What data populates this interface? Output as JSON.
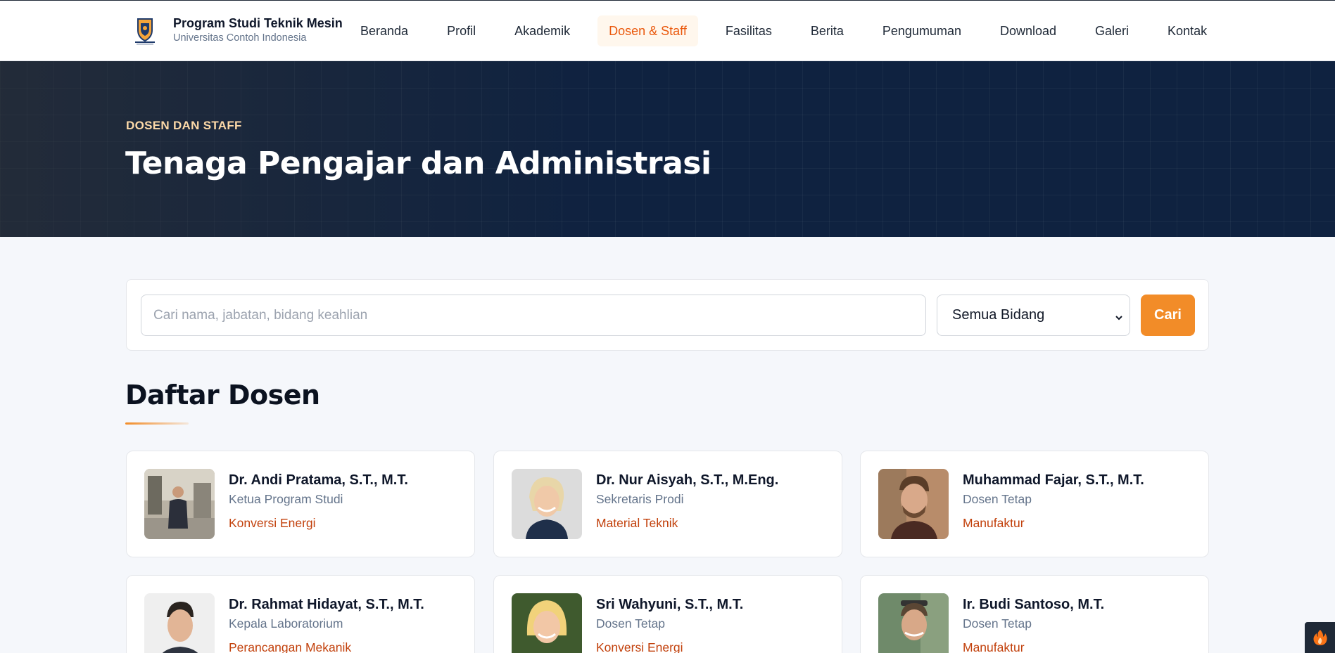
{
  "brand": {
    "title": "Program Studi Teknik Mesin",
    "subtitle": "Universitas Contoh Indonesia",
    "logo_icon": "university-crest-icon"
  },
  "nav": {
    "items": [
      {
        "label": "Beranda"
      },
      {
        "label": "Profil"
      },
      {
        "label": "Akademik"
      },
      {
        "label": "Dosen & Staff",
        "active": true
      },
      {
        "label": "Fasilitas"
      },
      {
        "label": "Berita"
      },
      {
        "label": "Pengumuman"
      },
      {
        "label": "Download"
      },
      {
        "label": "Galeri"
      },
      {
        "label": "Kontak"
      }
    ]
  },
  "hero": {
    "eyebrow": "DOSEN DAN STAFF",
    "title": "Tenaga Pengajar dan Administrasi"
  },
  "search": {
    "placeholder": "Cari nama, jabatan, bidang keahlian",
    "value": "",
    "filter_selected": "Semua Bidang",
    "button_label": "Cari"
  },
  "section": {
    "title": "Daftar Dosen"
  },
  "lecturers": [
    {
      "name": "Dr. Andi Pratama, S.T., M.T.",
      "role": "Ketua Program Studi",
      "field": "Konversi Energi"
    },
    {
      "name": "Dr. Nur Aisyah, S.T., M.Eng.",
      "role": "Sekretaris Prodi",
      "field": "Material Teknik"
    },
    {
      "name": "Muhammad Fajar, S.T., M.T.",
      "role": "Dosen Tetap",
      "field": "Manufaktur"
    },
    {
      "name": "Dr. Rahmat Hidayat, S.T., M.T.",
      "role": "Kepala Laboratorium",
      "field": "Perancangan Mekanik"
    },
    {
      "name": "Sri Wahyuni, S.T., M.T.",
      "role": "Dosen Tetap",
      "field": "Konversi Energi"
    },
    {
      "name": "Ir. Budi Santoso, M.T.",
      "role": "Dosen Tetap",
      "field": "Manufaktur"
    }
  ],
  "colors": {
    "accent": "#f28c28",
    "accent_text": "#ea580c",
    "hero_bg": "#0f2240",
    "field_text": "#c2410c"
  },
  "corner_widget": {
    "icon": "flame-icon"
  }
}
